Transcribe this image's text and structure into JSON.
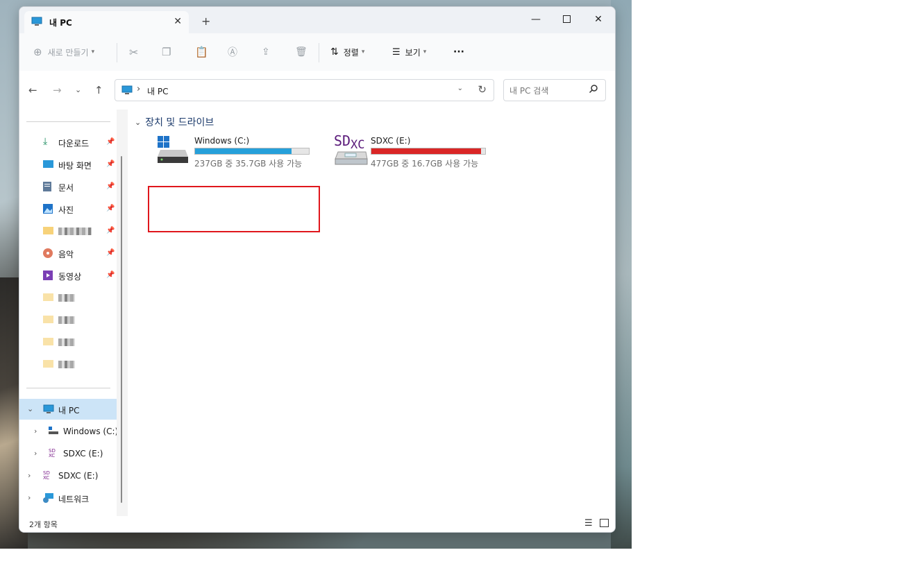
{
  "window": {
    "tab_title": "내 PC"
  },
  "toolbar": {
    "new_label": "새로 만들기",
    "sort_label": "정렬",
    "view_label": "보기",
    "more_label": "···"
  },
  "address": {
    "crumb": "내 PC",
    "search_placeholder": "내 PC 검색"
  },
  "sidebar": {
    "quick": [
      {
        "label": "다운로드",
        "icon": "download-icon"
      },
      {
        "label": "바탕 화면",
        "icon": "desktop-icon"
      },
      {
        "label": "문서",
        "icon": "document-icon"
      },
      {
        "label": "사진",
        "icon": "pictures-icon"
      },
      {
        "label": "",
        "icon": "folder-icon"
      },
      {
        "label": "음악",
        "icon": "music-icon"
      },
      {
        "label": "동영상",
        "icon": "video-icon"
      }
    ],
    "tree": {
      "this_pc": "내 PC",
      "windows_c": "Windows (C:)",
      "sdxc_e_child": "SDXC (E:)",
      "sdxc_e": "SDXC (E:)",
      "network": "네트워크"
    }
  },
  "content": {
    "group_header": "장치 및 드라이브",
    "drives": [
      {
        "name": "Windows (C:)",
        "free_text": "237GB 중 35.7GB 사용 가능",
        "used_fraction": 0.85,
        "bar_color": "#26a0da"
      },
      {
        "name": "SDXC (E:)",
        "free_text": "477GB 중 16.7GB 사용 가능",
        "used_fraction": 0.965,
        "bar_color": "#da2626",
        "logo_sd": "SD",
        "logo_xc": "XC"
      }
    ]
  },
  "status": {
    "item_count": "2개 항목"
  },
  "colors": {
    "accent": "#26a0da",
    "warning": "#da2626",
    "highlight_box": "#e0161c",
    "selected": "#cce4f7"
  }
}
